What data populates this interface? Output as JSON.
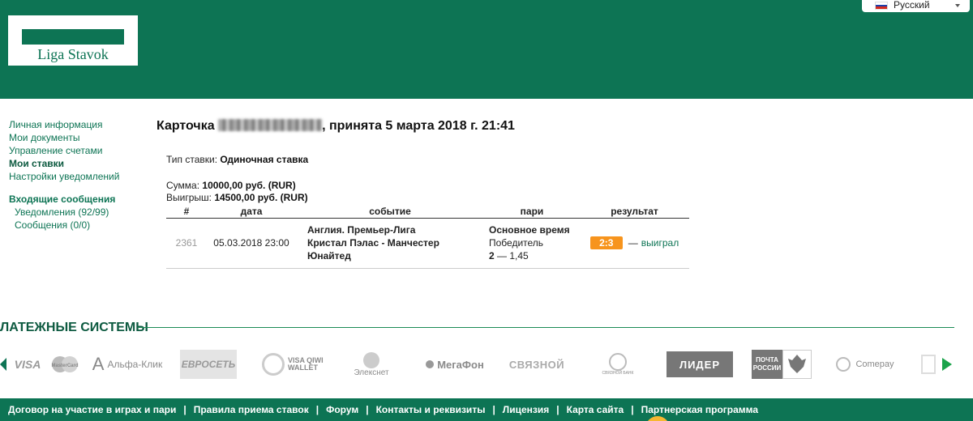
{
  "header": {
    "logo_text": "Liga Stavok",
    "language": "Русский",
    "flag_colors": [
      "#ffffff",
      "#1c3faa",
      "#d52b1e"
    ]
  },
  "sidebar": {
    "items": [
      {
        "label": "Личная информация"
      },
      {
        "label": "Мои документы"
      },
      {
        "label": "Управление счетами"
      },
      {
        "label": "Мои ставки",
        "active": true
      },
      {
        "label": "Настройки уведомлений"
      }
    ],
    "messages_heading": "Входящие сообщения",
    "sub_items": [
      {
        "label": "Уведомления (92/99)"
      },
      {
        "label": "Сообщения (0/0)"
      }
    ]
  },
  "card": {
    "title_prefix": "Карточка",
    "title_suffix": ", принята 5 марта 2018 г. 21:41",
    "bet_type_label": "Тип ставки:",
    "bet_type_value": "Одиночная ставка",
    "sum_label": "Сумма:",
    "sum_value": "10000,00 руб. (RUR)",
    "win_label": "Выигрыш:",
    "win_value": "14500,00 руб. (RUR)"
  },
  "table": {
    "headers": [
      "#",
      "дата",
      "событие",
      "пари",
      "результат"
    ],
    "rows": [
      {
        "num": "2361",
        "date": "05.03.2018 23:00",
        "league": "Англия. Премьер-Лига",
        "match": "Кристал Пэлас - Манчестер Юнайтед",
        "bet_period": "Основное время",
        "bet_market": "Победитель",
        "bet_pick": "2",
        "bet_odds": "— 1,45",
        "score": "2:3",
        "result_dash": "—",
        "result": "выиграл"
      }
    ]
  },
  "payments": {
    "title": "ЛАТЕЖНЫЕ СИСТЕМЫ",
    "logos": [
      "VISA",
      "MasterCard",
      "Альфа-Клик",
      "ЕВРОСЕТЬ",
      "VISA QIWI WALLET",
      "Элекснет",
      "МегаФон",
      "СВЯЗНОЙ",
      "СВЯЗНОЙ БАНК",
      "ЛИДЕР",
      "ПОЧТА РОССИИ",
      "Comepay"
    ]
  },
  "footer": {
    "links": [
      "Договор на участие в играх и пари",
      "Правила приема ставок",
      "Форум",
      "Контакты и реквизиты",
      "Лицензия",
      "Карта сайта",
      "Партнерская программа"
    ],
    "separator": "|"
  },
  "colors": {
    "brand_green": "#0d7454",
    "score_orange": "#f7941d"
  }
}
